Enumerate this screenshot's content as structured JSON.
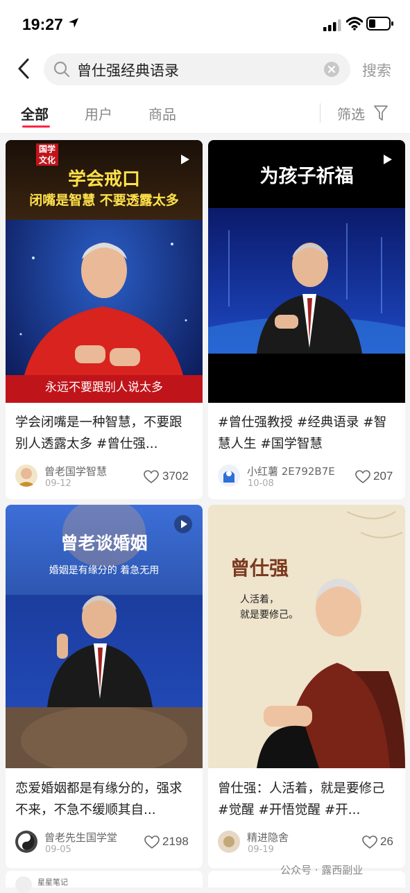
{
  "status": {
    "time": "19:27"
  },
  "search": {
    "query": "曾仕强经典语录",
    "button": "搜索"
  },
  "tabs": [
    {
      "label": "全部",
      "active": true
    },
    {
      "label": "用户",
      "active": false
    },
    {
      "label": "商品",
      "active": false
    }
  ],
  "filter": {
    "label": "筛选"
  },
  "cards": [
    {
      "thumb": {
        "badge": "国学文化",
        "headline1": "学会戒口",
        "headline2": "闭嘴是智慧 不要透露太多",
        "subtitle": "永远不要跟别人说太多"
      },
      "title": "学会闭嘴是一种智慧，不要跟别人透露太多 #曾仕强...",
      "author": "曾老国学智慧",
      "date": "09-12",
      "likes": "3702"
    },
    {
      "thumb": {
        "headline1": "为孩子祈福"
      },
      "title": "#曾仕强教授 #经典语录 #智慧人生 #国学智慧",
      "author": "小红薯 2E792B7E",
      "date": "10-08",
      "likes": "207"
    },
    {
      "thumb": {
        "headline1": "曾老谈婚姻",
        "headline2": "婚姻是有缘分的 着急无用"
      },
      "title": "恋爱婚姻都是有缘分的，强求不来，不急不缓顺其自...",
      "author": "曾老先生国学堂",
      "date": "09-05",
      "likes": "2198"
    },
    {
      "thumb": {
        "calligraphy": "曾仕强",
        "quote1": "人活着，",
        "quote2": "就是要修己。"
      },
      "title": "曾仕强：人活着，就是要修己 #觉醒 #开悟觉醒 #开...",
      "author": "精进隐舍",
      "date": "09-19",
      "likes": "26"
    }
  ],
  "peek": {
    "author": "星星笔记"
  },
  "watermark": "公众号 · 露西副业",
  "colors": {
    "accent": "#ff2442"
  }
}
